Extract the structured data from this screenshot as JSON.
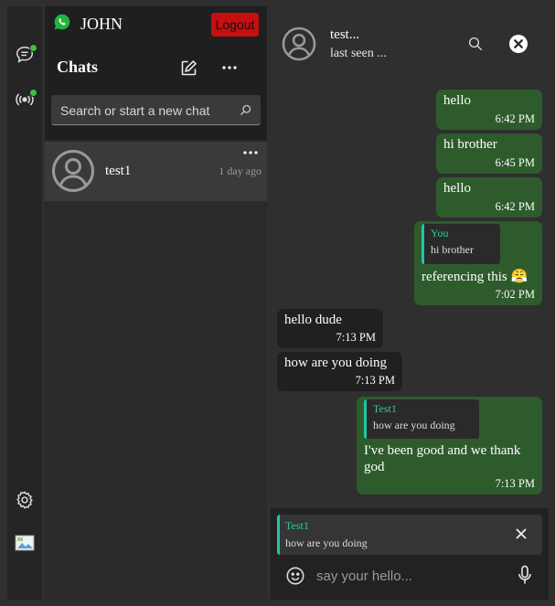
{
  "header": {
    "username": "JOHN",
    "logout_label": "Logout"
  },
  "sidebar": {
    "title": "Chats",
    "search_placeholder": "Search or start a new chat",
    "chats": [
      {
        "name": "test1",
        "time": "1 day ago"
      }
    ]
  },
  "conversation": {
    "contact_name": "test...",
    "status": "last seen ...",
    "messages": [
      {
        "dir": "out",
        "text": "hello",
        "time": "6:42 PM"
      },
      {
        "dir": "out",
        "text": "hi brother",
        "time": "6:45 PM"
      },
      {
        "dir": "out",
        "text": "hello",
        "time": "6:42 PM"
      },
      {
        "dir": "out",
        "quote_author": "You",
        "quote_text": "hi brother",
        "text": "referencing this 😤",
        "time": "7:02 PM"
      },
      {
        "dir": "in",
        "text": "hello dude",
        "time": "7:13 PM"
      },
      {
        "dir": "in",
        "text": "how are you doing",
        "time": "7:13 PM"
      },
      {
        "dir": "out",
        "quote_author": "Test1",
        "quote_text": "how are you doing",
        "text_line1": "I've been good and we thank",
        "text_line2": "god",
        "time": "7:13 PM"
      }
    ],
    "reply": {
      "author": "Test1",
      "text": "how are you doing"
    },
    "input_placeholder": "say your hello..."
  },
  "icons": [
    "whatsapp-icon",
    "chat-icon",
    "status-icon",
    "settings-icon",
    "broken-image-icon",
    "new-chat-icon",
    "more-icon",
    "search-icon",
    "avatar-icon",
    "close-icon",
    "emoji-icon",
    "microphone-icon"
  ],
  "colors": {
    "outgoing_bubble": "#2e5b2c",
    "incoming_bubble": "#202020",
    "logout": "#c41010",
    "quote_accent": "#1ec7a5",
    "online_dot": "#3ec13e"
  }
}
